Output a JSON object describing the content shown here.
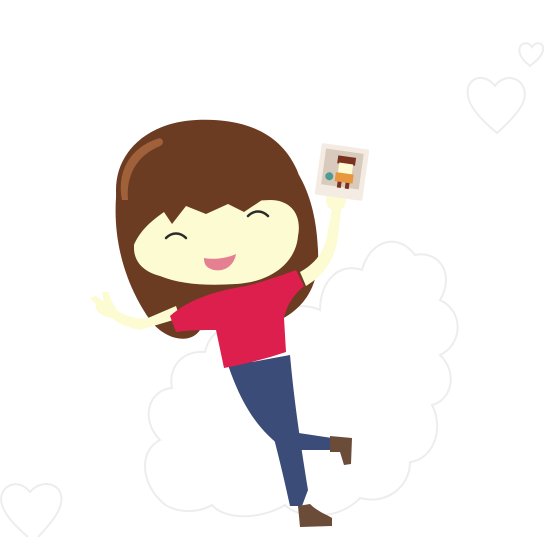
{
  "scene": {
    "subject_icon": "girl-with-photo-icon",
    "held_item_icon": "photo-card-icon",
    "decor_icons": [
      "heart-outline-icon",
      "cloud-outline-icon"
    ]
  },
  "colors": {
    "background": "#ffffff",
    "outline": "#ededed",
    "hair": "#6b3b22",
    "hair_highlight": "#a0603a",
    "skin": "#fdfbd2",
    "shirt": "#dc1f4c",
    "jeans": "#3c4c78",
    "shoes": "#6b4c38",
    "mouth": "#e57f92",
    "eye": "#2b2b2b",
    "photo_frame": "#f4ece3",
    "photo_bg": "#d8cbbd",
    "photo_person_shirt": "#e8973e",
    "photo_person_hair": "#7a3220",
    "photo_accent": "#4e9a94"
  }
}
